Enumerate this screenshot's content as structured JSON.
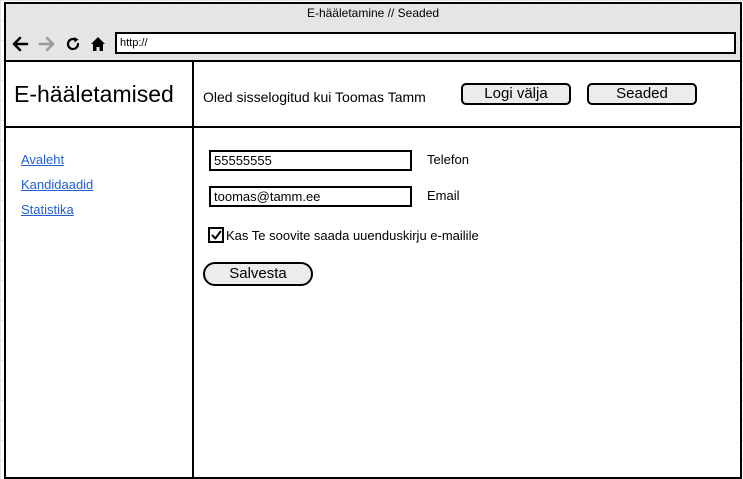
{
  "browser": {
    "window_title": "E-hääletamine // Seaded",
    "url": "http://"
  },
  "header": {
    "brand": "E-hääletamised",
    "logged_in_text": "Oled sisselogitud kui Toomas Tamm",
    "logout_label": "Logi välja",
    "settings_label": "Seaded"
  },
  "sidebar": {
    "items": [
      {
        "label": "Avaleht"
      },
      {
        "label": "Kandidaadid"
      },
      {
        "label": "Statistika"
      }
    ]
  },
  "form": {
    "phone": {
      "value": "55555555",
      "label": "Telefon"
    },
    "email": {
      "value": "toomas@tamm.ee",
      "label": "Email"
    },
    "newsletter": {
      "checked": true,
      "label": "Kas Te soovite saada uuenduskirju e-mailile"
    },
    "save_label": "Salvesta"
  },
  "icons": {
    "back": "arrow-left-icon",
    "forward": "arrow-right-icon",
    "reload": "reload-icon",
    "home": "home-icon",
    "check": "checkmark-icon"
  },
  "colors": {
    "link": "#1f5fcf",
    "button_fill": "#ececec",
    "chrome": "#e5e5e5"
  }
}
